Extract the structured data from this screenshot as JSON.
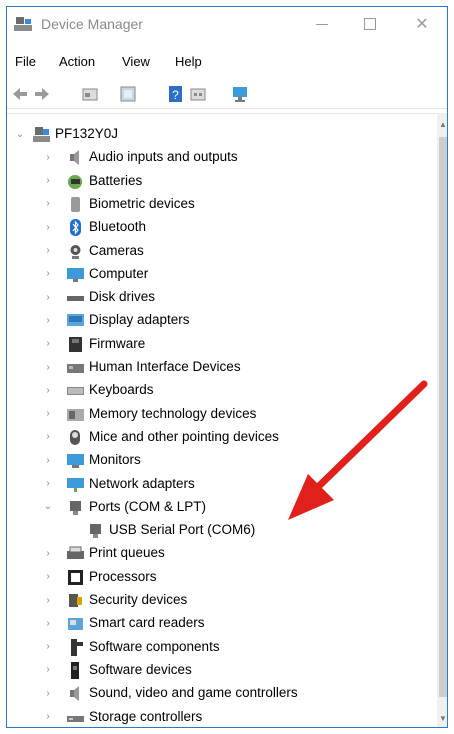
{
  "window": {
    "title": "Device Manager",
    "minimize_glyph": "",
    "maximize_glyph": "",
    "close_glyph": "✕"
  },
  "menu": {
    "file": "File",
    "action": "Action",
    "view": "View",
    "help": "Help"
  },
  "toolbar": {
    "icons": [
      "back-icon",
      "forward-icon",
      "properties-icon",
      "update-driver-icon",
      "help-icon",
      "resources-icon",
      "scan-hardware-icon"
    ]
  },
  "tree": {
    "root": "PF132Y0J",
    "items": [
      {
        "label": "Audio inputs and outputs",
        "icon": "speaker-icon",
        "expanded": false
      },
      {
        "label": "Batteries",
        "icon": "battery-icon",
        "expanded": false
      },
      {
        "label": "Biometric devices",
        "icon": "biometric-icon",
        "expanded": false
      },
      {
        "label": "Bluetooth",
        "icon": "bluetooth-icon",
        "expanded": false
      },
      {
        "label": "Cameras",
        "icon": "camera-icon",
        "expanded": false
      },
      {
        "label": "Computer",
        "icon": "computer-icon",
        "expanded": false
      },
      {
        "label": "Disk drives",
        "icon": "disk-drive-icon",
        "expanded": false
      },
      {
        "label": "Display adapters",
        "icon": "display-adapter-icon",
        "expanded": false
      },
      {
        "label": "Firmware",
        "icon": "firmware-icon",
        "expanded": false
      },
      {
        "label": "Human Interface Devices",
        "icon": "hid-icon",
        "expanded": false
      },
      {
        "label": "Keyboards",
        "icon": "keyboard-icon",
        "expanded": false
      },
      {
        "label": "Memory technology devices",
        "icon": "memory-icon",
        "expanded": false
      },
      {
        "label": "Mice and other pointing devices",
        "icon": "mouse-icon",
        "expanded": false
      },
      {
        "label": "Monitors",
        "icon": "monitor-icon",
        "expanded": false
      },
      {
        "label": "Network adapters",
        "icon": "network-adapter-icon",
        "expanded": false
      },
      {
        "label": "Ports (COM & LPT)",
        "icon": "port-icon",
        "expanded": true
      },
      {
        "label": "USB Serial Port (COM6)",
        "icon": "port-icon",
        "child": true
      },
      {
        "label": "Print queues",
        "icon": "printer-icon",
        "expanded": false
      },
      {
        "label": "Processors",
        "icon": "processor-icon",
        "expanded": false
      },
      {
        "label": "Security devices",
        "icon": "security-icon",
        "expanded": false
      },
      {
        "label": "Smart card readers",
        "icon": "smart-card-icon",
        "expanded": false
      },
      {
        "label": "Software components",
        "icon": "software-component-icon",
        "expanded": false
      },
      {
        "label": "Software devices",
        "icon": "software-device-icon",
        "expanded": false
      },
      {
        "label": "Sound, video and game controllers",
        "icon": "sound-icon",
        "expanded": false
      },
      {
        "label": "Storage controllers",
        "icon": "storage-icon",
        "expanded": false
      }
    ]
  },
  "colors": {
    "window_border": "#2b78c6",
    "arrow": "#e0201b"
  }
}
